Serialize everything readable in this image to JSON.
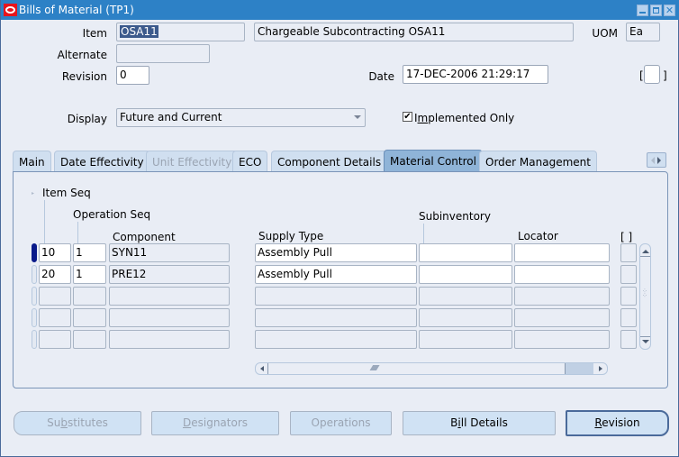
{
  "window": {
    "title": "Bills of Material (TP1)",
    "controls": [
      "minimize",
      "maximize",
      "close"
    ]
  },
  "header": {
    "item_label": "Item",
    "item_value": "OSA11",
    "item_description": "Chargeable Subcontracting OSA11",
    "uom_label": "UOM",
    "uom_value": "Ea",
    "alternate_label": "Alternate",
    "alternate_value": "",
    "revision_label": "Revision",
    "revision_value": "0",
    "date_label": "Date",
    "date_value": "17-DEC-2006 21:29:17",
    "flex_open": "[",
    "flex_close": "]",
    "display_label": "Display",
    "display_value": "Future and Current",
    "implemented_only_label": "Implemented Only",
    "implemented_only_mnemonic": "m",
    "implemented_only_checked": true
  },
  "tabs": [
    {
      "label": "Main",
      "state": "normal"
    },
    {
      "label": "Date Effectivity",
      "state": "normal"
    },
    {
      "label": "Unit Effectivity",
      "state": "disabled"
    },
    {
      "label": "ECO",
      "state": "normal"
    },
    {
      "label": "Component Details",
      "state": "normal"
    },
    {
      "label": "Material Control",
      "state": "active"
    },
    {
      "label": "Order Management",
      "state": "normal"
    }
  ],
  "grid": {
    "headers": {
      "item_seq": "Item Seq",
      "operation_seq": "Operation Seq",
      "component": "Component",
      "supply_type": "Supply Type",
      "subinventory": "Subinventory",
      "locator": "Locator",
      "flex": "[ ]"
    },
    "rows": [
      {
        "item_seq": "10",
        "operation_seq": "1",
        "component": "SYN11",
        "supply_type": "Assembly Pull",
        "subinventory": "",
        "locator": "",
        "current": true
      },
      {
        "item_seq": "20",
        "operation_seq": "1",
        "component": "PRE12",
        "supply_type": "Assembly Pull",
        "subinventory": "",
        "locator": "",
        "current": false
      },
      {
        "item_seq": "",
        "operation_seq": "",
        "component": "",
        "supply_type": "",
        "subinventory": "",
        "locator": "",
        "current": false
      },
      {
        "item_seq": "",
        "operation_seq": "",
        "component": "",
        "supply_type": "",
        "subinventory": "",
        "locator": "",
        "current": false
      },
      {
        "item_seq": "",
        "operation_seq": "",
        "component": "",
        "supply_type": "",
        "subinventory": "",
        "locator": "",
        "current": false
      }
    ]
  },
  "buttons": {
    "substitutes": {
      "pre": "Su",
      "mn": "b",
      "post": "stitutes",
      "state": "disabled"
    },
    "designators": {
      "pre": "",
      "mn": "D",
      "post": "esignators",
      "state": "disabled"
    },
    "operations": {
      "pre": "Operations",
      "mn": "",
      "post": "",
      "state": "disabled"
    },
    "bill_details": {
      "pre": "B",
      "mn": "i",
      "post": "ll Details",
      "state": "enabled"
    },
    "revision": {
      "pre": "",
      "mn": "R",
      "post": "evision",
      "state": "default"
    }
  },
  "colors": {
    "titlebar": "#2d81c6",
    "logo": "#e8141c",
    "active_tab": "#8fb4d8",
    "tab": "#d0dff0",
    "background": "#e9edf5",
    "selection": "#3c5a8c",
    "current_row_indicator": "#0a1a8a"
  }
}
